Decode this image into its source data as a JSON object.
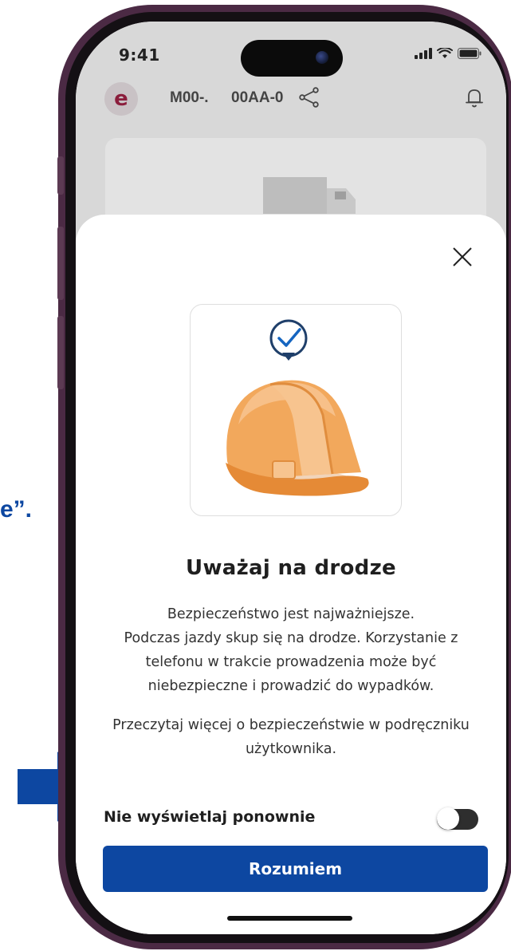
{
  "background": {
    "partial_text": "e”.",
    "accent_color": "#0d47a1"
  },
  "status_bar": {
    "time": "9:41",
    "icons": [
      "signal-icon",
      "wifi-icon",
      "battery-icon"
    ]
  },
  "app_header": {
    "logo_letter": "e",
    "plate_1": "M00-.",
    "plate_2": "00AA-0",
    "icons": [
      "share-icon",
      "bell-icon"
    ]
  },
  "modal": {
    "close_icon": "close-icon",
    "illustration": "hard-hat-with-check-illustration",
    "title": "Uważaj na drodze",
    "body_lines": [
      "Bezpieczeństwo jest najważniejsze.",
      "Podczas jazdy skup się na drodze. Korzystanie z",
      "telefonu w trakcie prowadzenia może być",
      "niebezpieczne i prowadzić do wypadków."
    ],
    "more_info_lines": [
      "Przeczytaj więcej o bezpieczeństwie w podręczniku",
      "użytkownika."
    ],
    "toggle_label": "Nie wyświetlaj ponownie",
    "toggle_on": false,
    "button_label": "Rozumiem",
    "button_color": "#0d47a1"
  }
}
